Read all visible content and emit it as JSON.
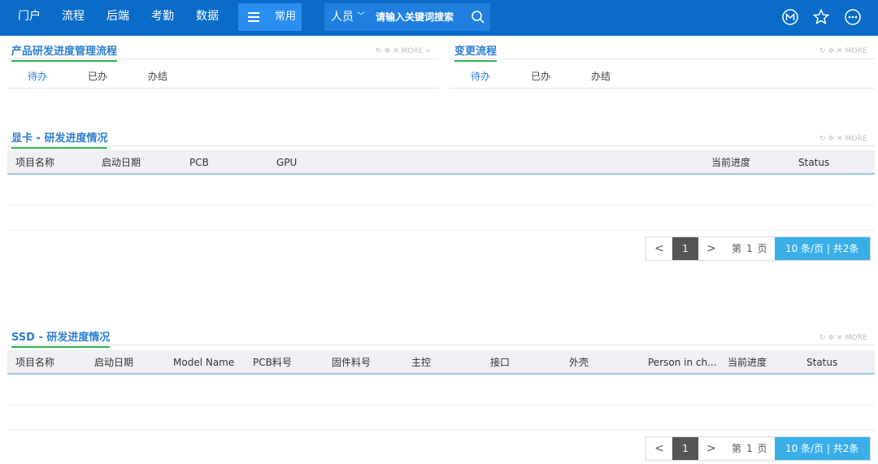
{
  "nav": {
    "items": [
      "门户",
      "流程",
      "后端",
      "考勤",
      "数据"
    ],
    "common_label": "常用",
    "search": {
      "scope": "人员",
      "placeholder": "请输入关键词搜索"
    },
    "right_icons": [
      "m-circle-icon",
      "star-icon",
      "more-circle-icon"
    ]
  },
  "tools_more_label": "MORE",
  "panels": {
    "product_flow": {
      "title": "产品研发进度管理流程",
      "tabs": [
        "待办",
        "已办",
        "办结"
      ],
      "active_tab": 0
    },
    "change_flow": {
      "title": "变更流程",
      "tabs": [
        "待办",
        "已办",
        "办结"
      ],
      "active_tab": 0
    },
    "gpu": {
      "title": "显卡 - 研发进度情况",
      "columns": [
        "项目名称",
        "启动日期",
        "PCB",
        "GPU",
        "当前进度",
        "Status"
      ],
      "pager": {
        "prev": "<",
        "current": "1",
        "next": ">",
        "page_prefix": "第",
        "page_num": "1",
        "page_suffix": "页",
        "size_text": "10  条/页 | 共2条"
      }
    },
    "ssd": {
      "title": "SSD - 研发进度情况",
      "columns": [
        "项目名称",
        "启动日期",
        "Model Name",
        "PCB料号",
        "固件料号",
        "主控",
        "接口",
        "外壳",
        "Person in ch...",
        "当前进度",
        "Status"
      ],
      "pager": {
        "prev": "<",
        "current": "1",
        "next": ">",
        "page_prefix": "第",
        "page_num": "1",
        "page_suffix": "页",
        "size_text": "10  条/页 | 共2条"
      }
    }
  },
  "colors": {
    "nav_bg": "#0a6bc8",
    "accent": "#2e7fd1",
    "title_underline": "#2fb34a",
    "pager_size_bg": "#3aaee8"
  }
}
